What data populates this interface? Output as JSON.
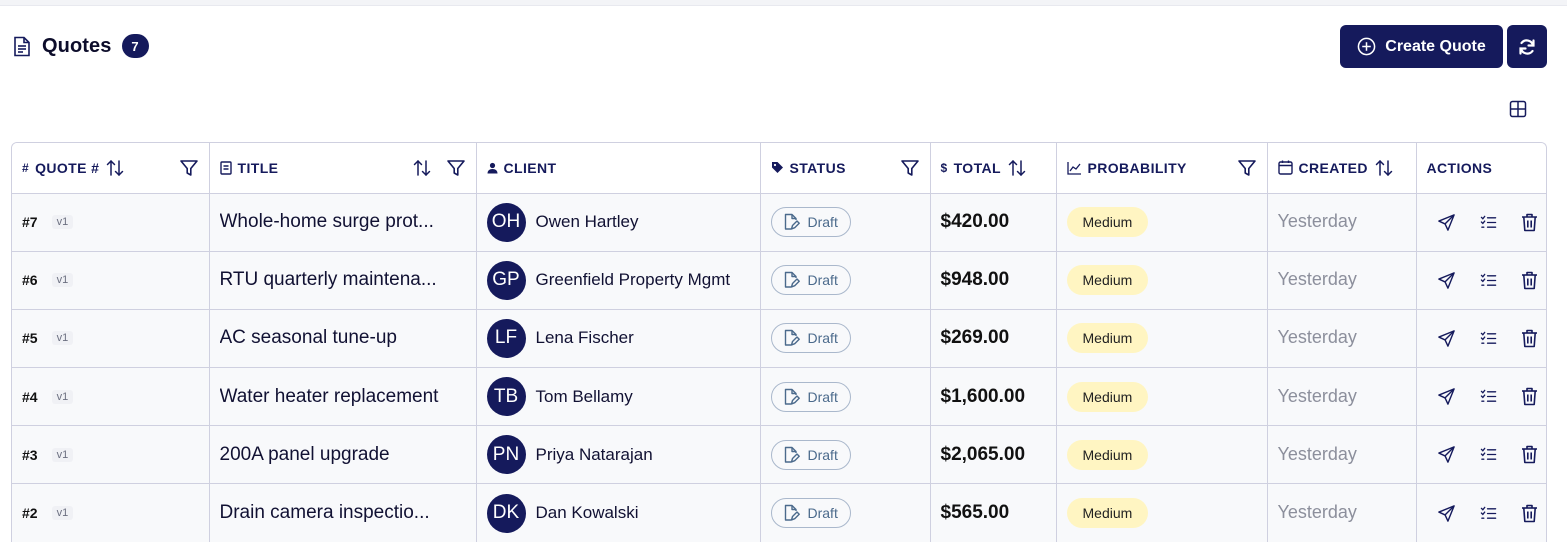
{
  "header": {
    "title": "Quotes",
    "count": "7"
  },
  "toolbar": {
    "create_label": "Create Quote"
  },
  "columns": {
    "quote": "QUOTE #",
    "title": "TITLE",
    "client": "CLIENT",
    "status": "STATUS",
    "total": "TOTAL",
    "probability": "PROBABILITY",
    "created": "CREATED",
    "actions": "ACTIONS",
    "quote_symbol": "#",
    "total_symbol": "$"
  },
  "rows": [
    {
      "num": "#7",
      "version": "v1",
      "title": "Whole-home surge prot...",
      "initials": "OH",
      "client": "Owen Hartley",
      "status": "Draft",
      "total": "$420.00",
      "probability": "Medium",
      "created": "Yesterday"
    },
    {
      "num": "#6",
      "version": "v1",
      "title": "RTU quarterly maintena...",
      "initials": "GP",
      "client": "Greenfield Property Mgmt",
      "status": "Draft",
      "total": "$948.00",
      "probability": "Medium",
      "created": "Yesterday"
    },
    {
      "num": "#5",
      "version": "v1",
      "title": "AC seasonal tune-up",
      "initials": "LF",
      "client": "Lena Fischer",
      "status": "Draft",
      "total": "$269.00",
      "probability": "Medium",
      "created": "Yesterday"
    },
    {
      "num": "#4",
      "version": "v1",
      "title": "Water heater replacement",
      "initials": "TB",
      "client": "Tom Bellamy",
      "status": "Draft",
      "total": "$1,600.00",
      "probability": "Medium",
      "created": "Yesterday"
    },
    {
      "num": "#3",
      "version": "v1",
      "title": "200A panel upgrade",
      "initials": "PN",
      "client": "Priya Natarajan",
      "status": "Draft",
      "total": "$2,065.00",
      "probability": "Medium",
      "created": "Yesterday"
    },
    {
      "num": "#2",
      "version": "v1",
      "title": "Drain camera inspectio...",
      "initials": "DK",
      "client": "Dan Kowalski",
      "status": "Draft",
      "total": "$565.00",
      "probability": "Medium",
      "created": "Yesterday"
    }
  ],
  "colors": {
    "primary": "#151a5c",
    "probability_bg": "#fff5c2",
    "status_text": "#4b6a8c"
  },
  "icons": {
    "header": "document-icon",
    "create": "plus-circle-icon",
    "refresh": "refresh-icon",
    "columns": "grid-icon",
    "row_actions": [
      "send-icon",
      "checklist-icon",
      "trash-icon"
    ]
  }
}
